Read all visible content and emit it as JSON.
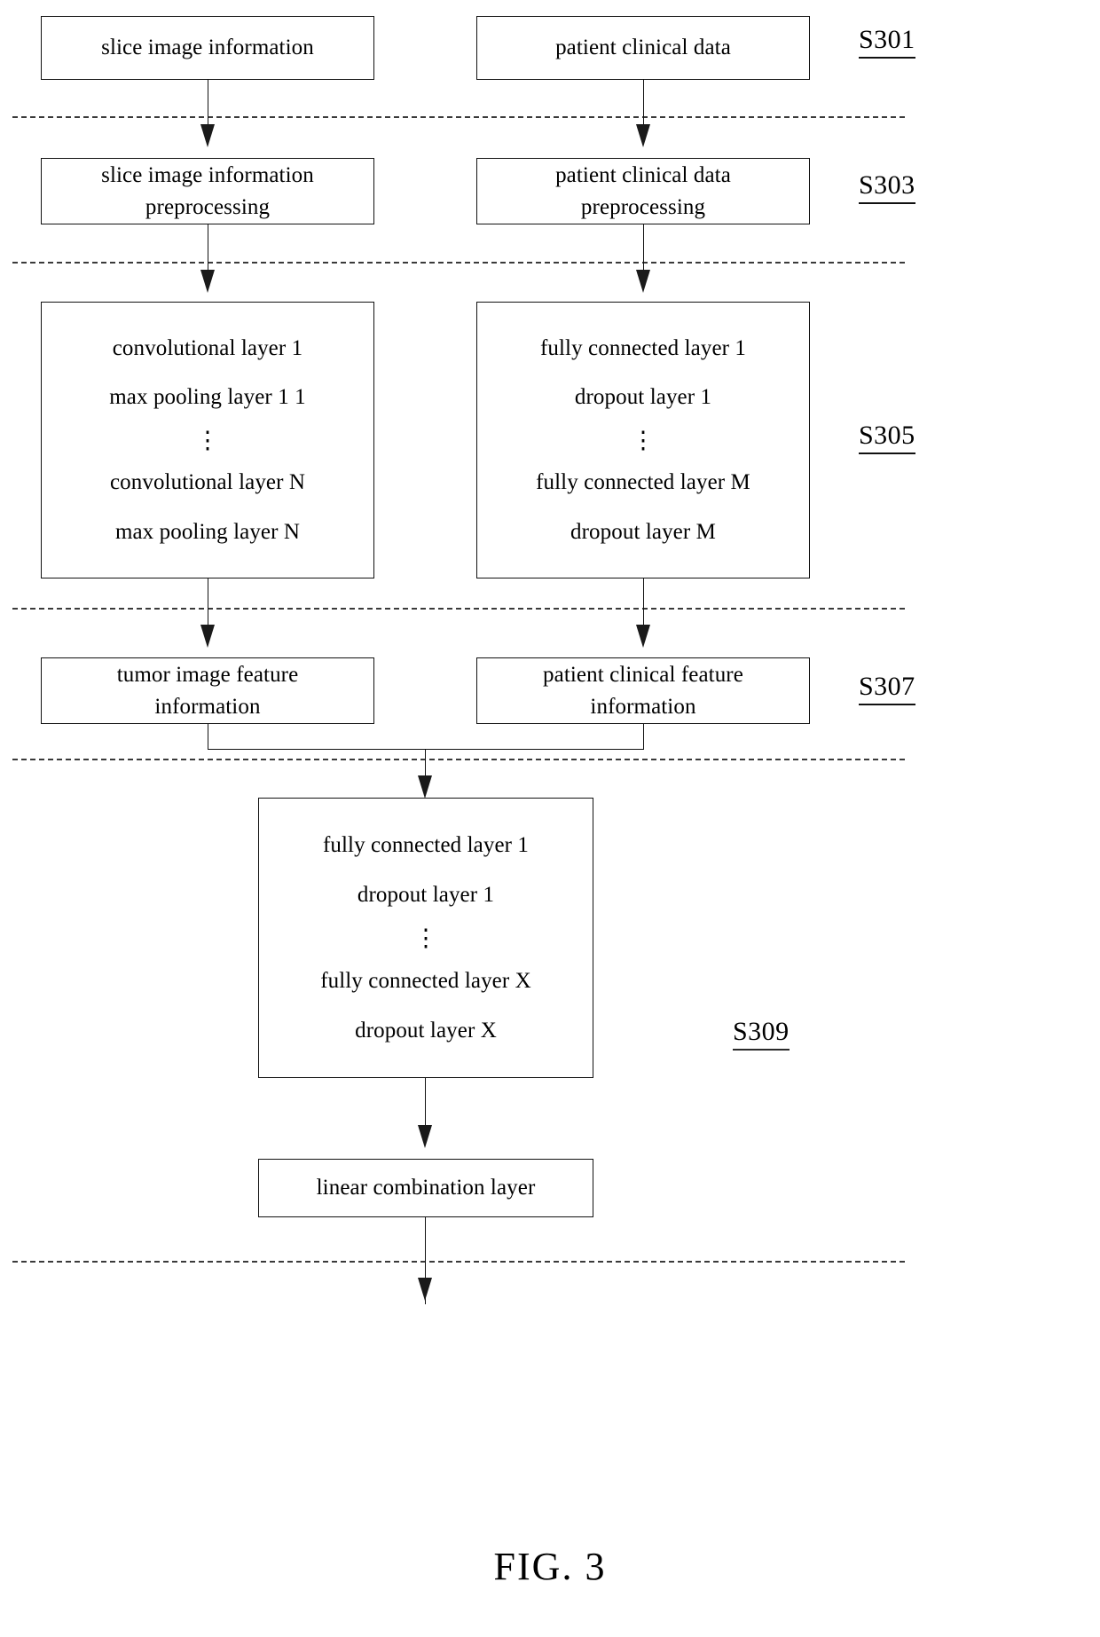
{
  "figure": {
    "caption": "FIG. 3"
  },
  "steps": [
    {
      "id": "s301",
      "label": "S301"
    },
    {
      "id": "s303",
      "label": "S303"
    },
    {
      "id": "s305",
      "label": "S305"
    },
    {
      "id": "s307",
      "label": "S307"
    },
    {
      "id": "s309",
      "label": "S309"
    }
  ],
  "boxes": {
    "slice_image_information": {
      "line1": "slice image information"
    },
    "patient_clinical_data": {
      "line1": "patient clinical data"
    },
    "slice_image_preprocessing": {
      "line1": "slice image information",
      "line2": "preprocessing"
    },
    "patient_clinical_preprocessing": {
      "line1": "patient clinical data",
      "line2": "preprocessing"
    },
    "cnn_stack": {
      "line1": "convolutional layer 1",
      "line2": "max pooling layer 1 1",
      "ellipsis": "⋮",
      "line3": "convolutional layer N",
      "line4": "max pooling layer N"
    },
    "fc_stack": {
      "line1": "fully connected layer 1",
      "line2": "dropout layer 1",
      "ellipsis": "⋮",
      "line3": "fully connected layer M",
      "line4": "dropout layer M"
    },
    "tumor_image_feature": {
      "line1": "tumor image feature",
      "line2": "information"
    },
    "patient_clinical_feature": {
      "line1": "patient clinical feature",
      "line2": "information"
    },
    "fusion_stack": {
      "line1": "fully connected layer 1",
      "line2": "dropout layer 1",
      "ellipsis": "⋮",
      "line3": "fully connected layer X",
      "line4": "dropout layer X"
    },
    "linear_combination": {
      "line1": "linear combination layer"
    }
  }
}
